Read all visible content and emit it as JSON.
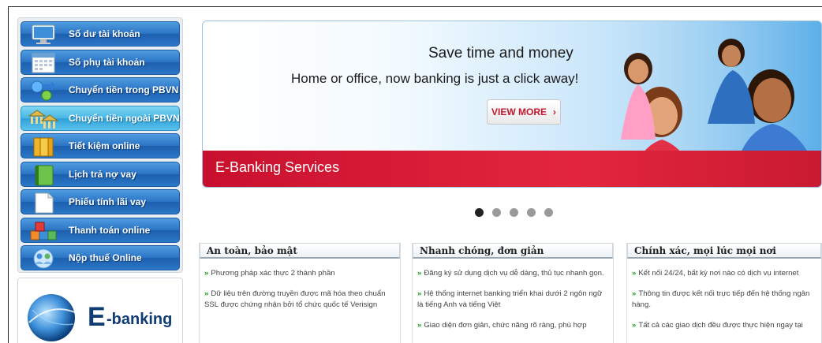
{
  "sidebar": {
    "items": [
      {
        "label": "Số dư tài khoản",
        "icon": "monitor-icon"
      },
      {
        "label": "Số phụ tài khoản",
        "icon": "calendar-icon"
      },
      {
        "label": "Chuyển tiền trong PBVN",
        "icon": "transfer-icon"
      },
      {
        "label": "Chuyển tiền ngoài PBVN",
        "icon": "bank-icon"
      },
      {
        "label": "Tiết kiệm online",
        "icon": "binder-icon"
      },
      {
        "label": "Lịch trả nợ vay",
        "icon": "notebook-icon"
      },
      {
        "label": "Phiếu tính lãi vay",
        "icon": "document-icon"
      },
      {
        "label": "Thanh toán online",
        "icon": "cubes-icon"
      },
      {
        "label": "Nộp thuế Online",
        "icon": "users-icon"
      }
    ],
    "active_index": 3
  },
  "ebanking": {
    "logo_text": "E-banking"
  },
  "banner": {
    "title": "Save time and money",
    "subtitle": "Home or office, now banking is just a click away!",
    "button": "VIEW MORE",
    "heading": "E-Banking Services",
    "accent": "#c8102e"
  },
  "slider": {
    "count": 5,
    "active": 0
  },
  "features": [
    {
      "title": "An toàn, bảo mật",
      "items": [
        "Phương pháp xác thực 2 thành phần",
        "Dữ liệu trên đường truyền được mã hóa theo chuẩn SSL được chứng nhận bởi tổ chức quốc tế Verisign"
      ]
    },
    {
      "title": "Nhanh chóng, đơn giản",
      "items": [
        "Đăng ký sử dụng dịch vụ dễ dàng, thủ tục nhanh gọn.",
        "Hệ thống internet banking triển khai dưới 2 ngôn ngữ là tiếng Anh và tiếng Việt",
        "Giao diện đơn giản, chức năng rõ ràng, phù hợp"
      ]
    },
    {
      "title": "Chính xác, mọi lúc mọi nơi",
      "items": [
        "Kết nối 24/24, bất kỳ nơi nào có dịch vụ internet",
        "Thông tin được kết nối trực tiếp đến hệ thống ngân hàng.",
        "Tất cả các giao dịch đều được thực hiện ngay tại"
      ]
    }
  ]
}
